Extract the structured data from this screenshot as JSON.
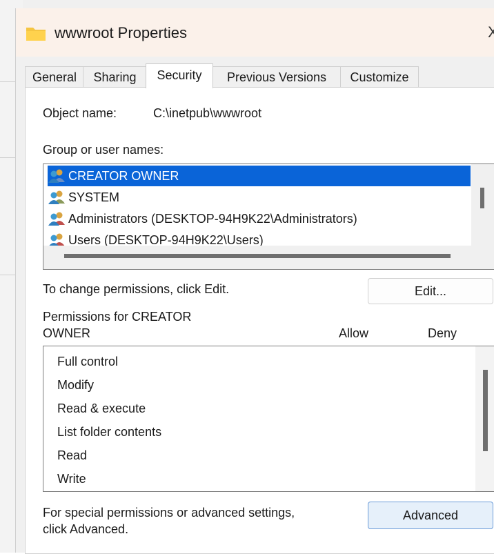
{
  "window": {
    "title": "wwwroot Properties",
    "close_glyph": "X"
  },
  "tabs": [
    {
      "label": "General",
      "active": false
    },
    {
      "label": "Sharing",
      "active": false
    },
    {
      "label": "Security",
      "active": true
    },
    {
      "label": "Previous Versions",
      "active": false
    },
    {
      "label": "Customize",
      "active": false
    }
  ],
  "security": {
    "object_name_label": "Object name:",
    "object_name_value": "C:\\inetpub\\wwwroot",
    "group_label": "Group or user names:",
    "users": [
      {
        "name": "CREATOR OWNER",
        "selected": true,
        "icon": "users-icon"
      },
      {
        "name": "SYSTEM",
        "selected": false,
        "icon": "users-icon"
      },
      {
        "name": "Administrators (DESKTOP-94H9K22\\Administrators)",
        "selected": false,
        "icon": "users-icon"
      },
      {
        "name": "Users (DESKTOP-94H9K22\\Users)",
        "selected": false,
        "icon": "users-icon"
      }
    ],
    "change_text": "To change permissions, click Edit.",
    "edit_button": "Edit...",
    "permissions_for_line1": "Permissions for CREATOR",
    "permissions_for_line2": "OWNER",
    "allow_header": "Allow",
    "deny_header": "Deny",
    "permissions": [
      "Full control",
      "Modify",
      "Read & execute",
      "List folder contents",
      "Read",
      "Write"
    ],
    "advanced_text_line1": "For special permissions or advanced settings,",
    "advanced_text_line2": "click Advanced.",
    "advanced_button": "Advanced"
  },
  "colors": {
    "selection": "#0a64d8",
    "titlebar": "#fbf1ea",
    "folder": "#f5c542"
  }
}
